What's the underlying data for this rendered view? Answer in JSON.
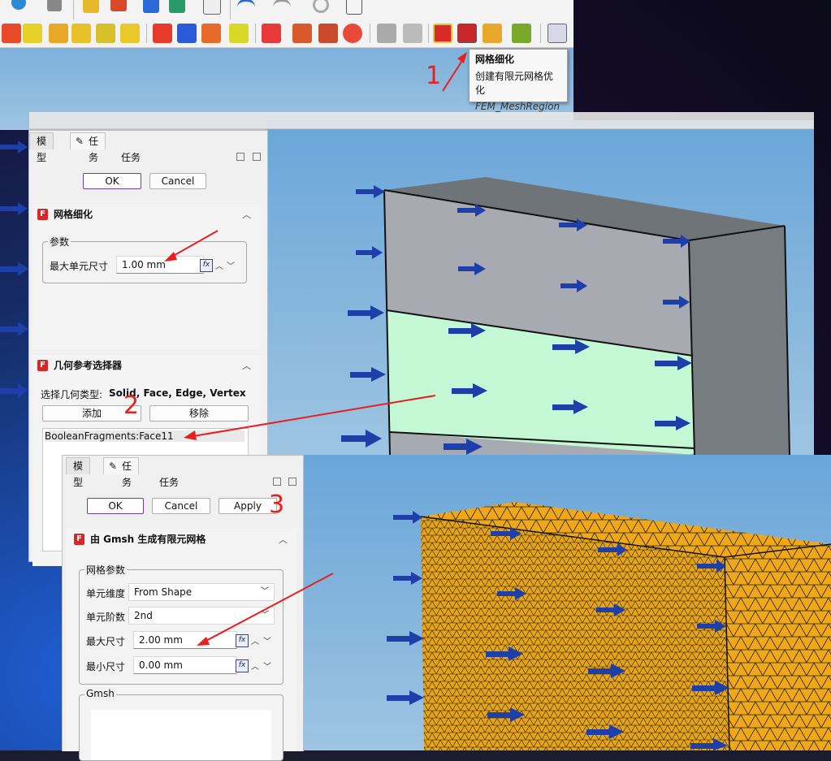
{
  "tooltip": {
    "title": "网格细化",
    "description": "创建有限元网格优化",
    "command": "FEM_MeshRegion"
  },
  "panel1": {
    "tabs": [
      "模型",
      "任务"
    ],
    "title": "任务",
    "ok_label": "OK",
    "cancel_label": "Cancel",
    "mesh_region": {
      "header": "网格细化",
      "group_label": "参数",
      "max_size_label": "最大单元尺寸",
      "max_size_value": "1.00 mm"
    },
    "geo_selector": {
      "header": "几何参考选择器",
      "type_label": "选择几何类型:",
      "type_value": "Solid, Face, Edge, Vertex",
      "add_label": "添加",
      "remove_label": "移除",
      "selected_item": "BooleanFragments:Face11"
    }
  },
  "panel2": {
    "tabs": [
      "模型",
      "任务"
    ],
    "title": "任务",
    "ok_label": "OK",
    "cancel_label": "Cancel",
    "apply_label": "Apply",
    "gmsh_section": {
      "header": "由 Gmsh 生成有限元网格",
      "group_label": "网格参数",
      "dimension_label": "单元维度",
      "dimension_value": "From Shape",
      "order_label": "单元阶数",
      "order_value": "2nd",
      "max_label": "最大尺寸",
      "max_value": "2.00 mm",
      "min_label": "最小尺寸",
      "min_value": "0.00 mm",
      "gmsh_group_label": "Gmsh"
    }
  },
  "annotations": {
    "step1": "1",
    "step2": "2",
    "step3": "3"
  },
  "colors": {
    "annotation_red": "#e62020",
    "mesh_orange": "#f0a818",
    "selected_face": "#c4f7d4",
    "load_arrow": "#1e3fa8"
  }
}
